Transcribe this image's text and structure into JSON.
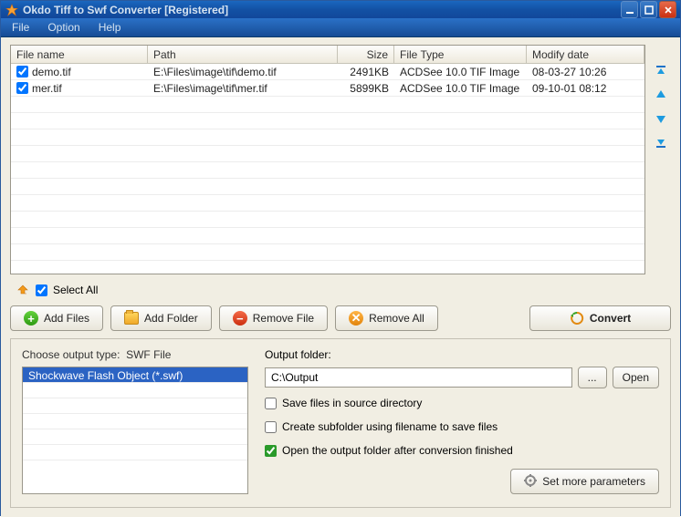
{
  "title": "Okdo Tiff to Swf Converter [Registered]",
  "menu": {
    "file": "File",
    "option": "Option",
    "help": "Help"
  },
  "columns": {
    "name": "File name",
    "path": "Path",
    "size": "Size",
    "type": "File Type",
    "date": "Modify date"
  },
  "files": [
    {
      "checked": true,
      "name": "demo.tif",
      "path": "E:\\Files\\image\\tif\\demo.tif",
      "size": "2491KB",
      "type": "ACDSee 10.0 TIF Image",
      "date": "08-03-27 10:26"
    },
    {
      "checked": true,
      "name": "mer.tif",
      "path": "E:\\Files\\image\\tif\\mer.tif",
      "size": "5899KB",
      "type": "ACDSee 10.0 TIF Image",
      "date": "09-10-01 08:12"
    }
  ],
  "select_all": {
    "checked": true,
    "label": "Select All"
  },
  "buttons": {
    "add_files": "Add Files",
    "add_folder": "Add Folder",
    "remove_file": "Remove File",
    "remove_all": "Remove All",
    "convert": "Convert",
    "browse": "...",
    "open": "Open",
    "more_params": "Set more parameters"
  },
  "output_type": {
    "label_prefix": "Choose output type:",
    "label_value": "SWF File",
    "items": [
      "Shockwave Flash Object (*.swf)"
    ],
    "selected_index": 0
  },
  "output_folder": {
    "label": "Output folder:",
    "value": "C:\\Output"
  },
  "options": {
    "save_in_source": {
      "checked": false,
      "label": "Save files in source directory"
    },
    "create_subfolder": {
      "checked": false,
      "label": "Create subfolder using filename to save files"
    },
    "open_after": {
      "checked": true,
      "label": "Open the output folder after conversion finished"
    }
  }
}
